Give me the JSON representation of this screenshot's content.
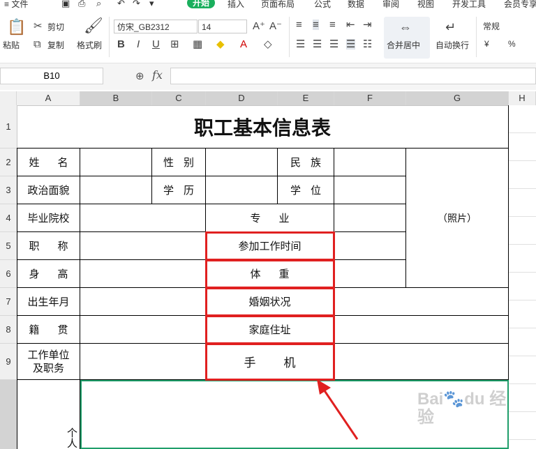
{
  "menu": {
    "file": "≡ 文件",
    "tabs": [
      "开始",
      "插入",
      "页面布局",
      "公式",
      "数据",
      "审阅",
      "视图",
      "开发工具",
      "会员专享"
    ]
  },
  "ribbon": {
    "paste": "粘贴",
    "cut": "剪切",
    "copy": "复制",
    "format_painter": "格式刷",
    "font_name": "仿宋_GB2312",
    "font_size": "14",
    "merge_center": "合并居中",
    "wrap_text": "自动换行",
    "number_format": "常规",
    "currency": "¥",
    "percent": "%"
  },
  "formula_bar": {
    "cell_ref": "B10",
    "fx": "fx",
    "value": ""
  },
  "columns": [
    "A",
    "B",
    "C",
    "D",
    "E",
    "F",
    "G",
    "H"
  ],
  "rows": [
    "1",
    "2",
    "3",
    "4",
    "5",
    "6",
    "7",
    "8",
    "9"
  ],
  "sheet": {
    "title": "职工基本信息表",
    "name_label": "姓名",
    "gender_label": "性别",
    "ethnicity_label": "民族",
    "political_label": "政治面貌",
    "education_label": "学历",
    "degree_label": "学位",
    "school_label": "毕业院校",
    "major_label": "专业",
    "photo_label": "（照片）",
    "title_label": "职称",
    "work_start_label": "参加工作时间",
    "height_label": "身高",
    "weight_label": "体重",
    "birth_label": "出生年月",
    "marital_label": "婚姻状况",
    "origin_label": "籍贯",
    "address_label": "家庭住址",
    "employer_label_1": "工作单位",
    "employer_label_2": "及职务",
    "phone_label": "手机",
    "personal_label": "个人"
  },
  "colors": {
    "accent": "#1aaf5d",
    "highlight_border": "#e02020",
    "selection_border": "#1f9e6a",
    "arrow": "#e02020"
  },
  "watermark": "Baidu 经验  jingyan.baidu.com"
}
